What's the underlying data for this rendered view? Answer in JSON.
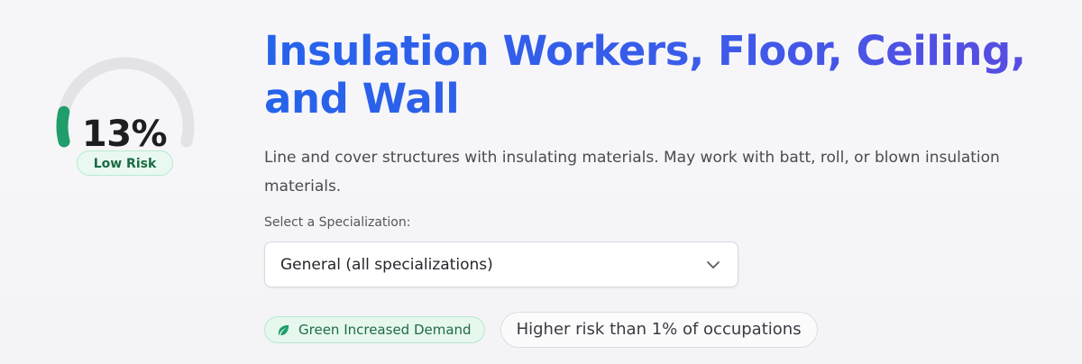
{
  "risk": {
    "percent": 13,
    "value_label": "13%",
    "level_label": "Low Risk",
    "colors": {
      "track": "#e3e3e6",
      "fill": "#1f9d6a"
    }
  },
  "occupation": {
    "title": "Insulation Workers, Floor, Ceiling, and Wall",
    "description": "Line and cover structures with insulating materials. May work with batt, roll, or blown insulation materials."
  },
  "specialization": {
    "label": "Select a Specialization:",
    "selected": "General (all specializations)",
    "icon": "chevron-down-icon"
  },
  "tags": {
    "green": {
      "label": "Green Increased Demand",
      "icon": "leaf-icon",
      "color": "#1f6b47"
    },
    "comparison": {
      "label": "Higher risk than 1% of occupations"
    }
  },
  "theme": {
    "title_gradient_start": "#2563eb",
    "title_gradient_end": "#5b4be0"
  }
}
